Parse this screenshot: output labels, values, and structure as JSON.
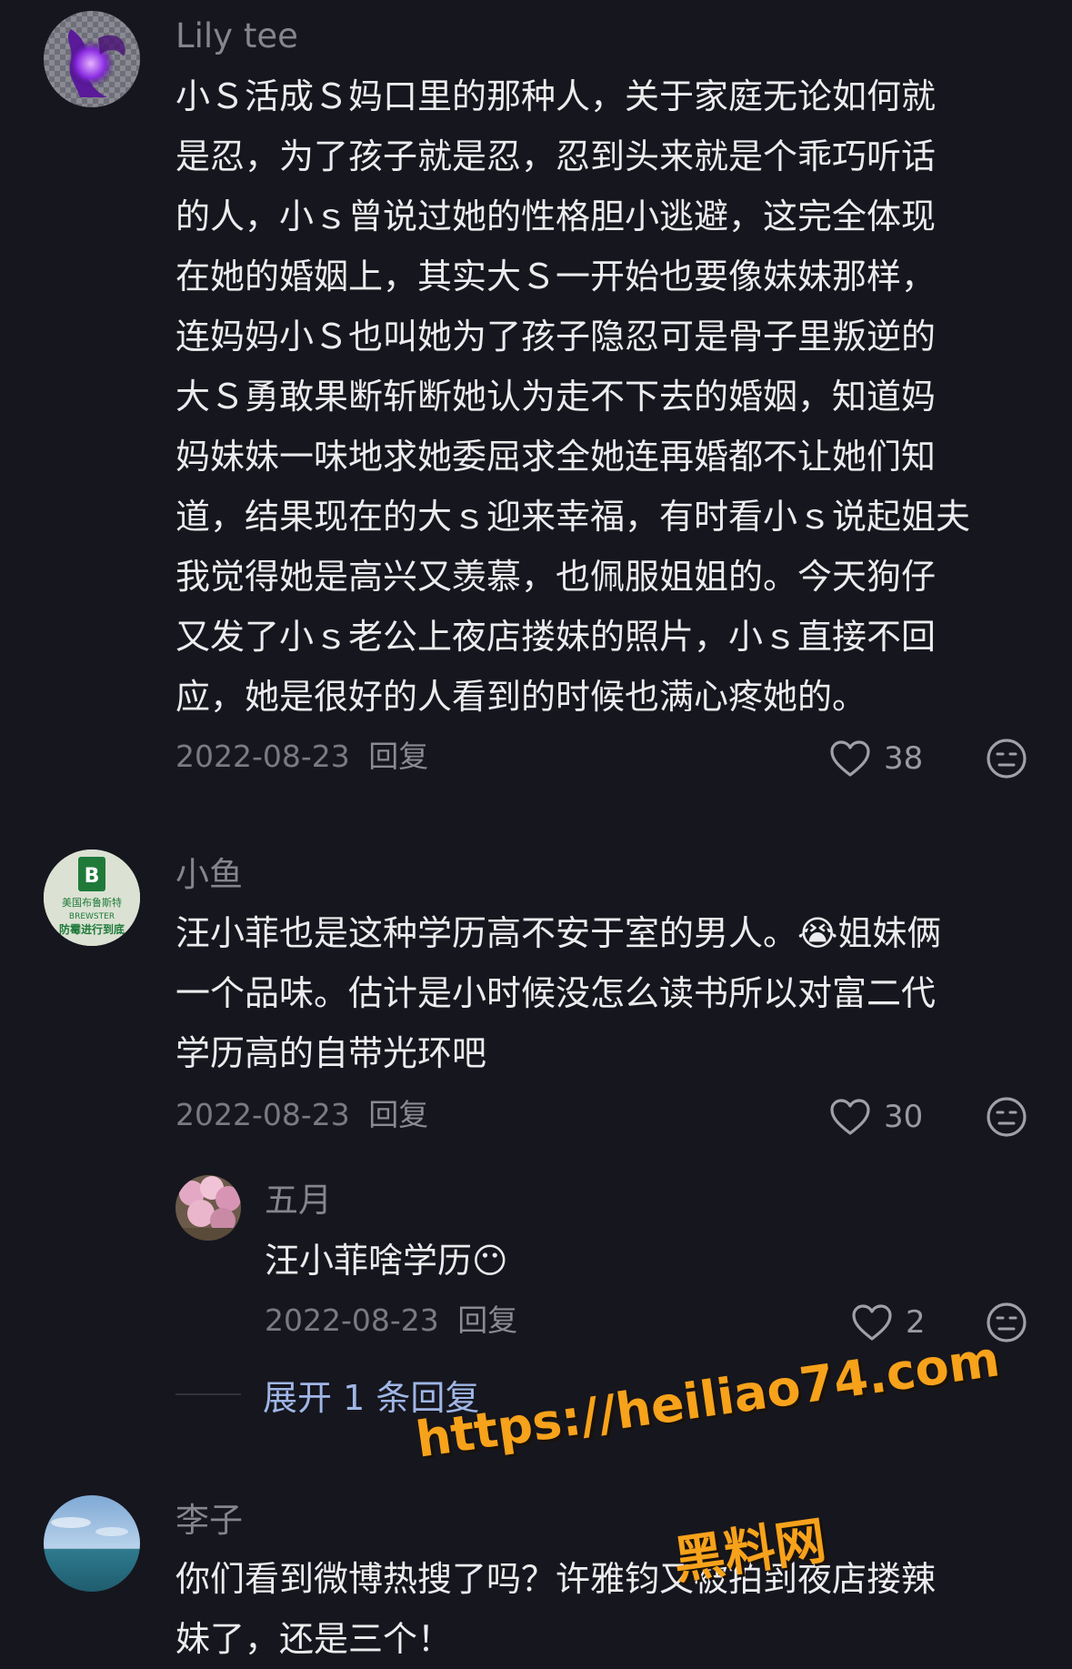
{
  "comments": [
    {
      "username": "Lily tee",
      "lines": [
        "小Ｓ活成Ｓ妈口里的那种人，关于家庭无论如何就",
        "是忍，为了孩子就是忍，忍到头来就是个乖巧听话",
        "的人，小ｓ曾说过她的性格胆小逃避，这完全体现",
        "在她的婚姻上，其实大Ｓ一开始也要像妹妹那样，",
        "连妈妈小Ｓ也叫她为了孩子隐忍可是骨子里叛逆的",
        "大Ｓ勇敢果断斩断她认为走不下去的婚姻，知道妈",
        "妈妹妹一味地求她委屈求全她连再婚都不让她们知",
        "道，结果现在的大ｓ迎来幸福，有时看小ｓ说起姐夫",
        "我觉得她是高兴又羡慕，也佩服姐姐的。今天狗仔",
        "又发了小ｓ老公上夜店搂妹的照片，小ｓ直接不回",
        "应，她是很好的人看到的时候也满心疼她的。"
      ],
      "date": "2022-08-23",
      "reply_label": "回复",
      "likes": "38"
    },
    {
      "username": "小鱼",
      "avatar_text": [
        "美国布鲁斯特",
        "BREWSTER",
        "防霉进行到底"
      ],
      "lines": [
        "汪小菲也是这种学历高不安于室的男人。😭姐妹俩",
        "一个品味。估计是小时候没怎么读书所以对富二代",
        "学历高的自带光环吧"
      ],
      "date": "2022-08-23",
      "reply_label": "回复",
      "likes": "30"
    },
    {
      "username": "五月",
      "lines": [
        "汪小菲啥学历😶"
      ],
      "date": "2022-08-23",
      "reply_label": "回复",
      "likes": "2"
    },
    {
      "username": "李子",
      "lines": [
        "你们看到微博热搜了吗？许雅钧又被拍到夜店搂辣",
        "妹了，还是三个！"
      ]
    }
  ],
  "expand_replies": "展开 1 条回复",
  "watermark": {
    "url": "https://heiliao74.com",
    "name": "黑料网"
  },
  "colors": {
    "background": "#16161e",
    "text": "#ececee",
    "muted": "#85858c",
    "link": "#9fb6e6",
    "watermark": "#f7a21b"
  }
}
